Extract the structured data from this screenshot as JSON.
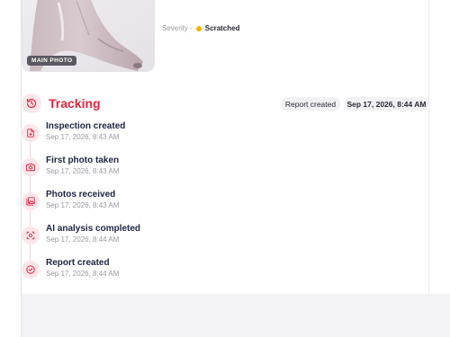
{
  "photo": {
    "tag": "MAIN PHOTO"
  },
  "severity": {
    "label": "Severity ·",
    "value": "Scratched",
    "dot_color": "#f4b400"
  },
  "tracking": {
    "title": "Tracking",
    "status_pill": "Report created",
    "date_pill": "Sep 17, 2026, 8:44 AM",
    "accent_color": "#e0243f",
    "events": [
      {
        "title": "Inspection created",
        "time": "Sep 17, 2026, 8:43 AM",
        "icon": "file-icon"
      },
      {
        "title": "First photo taken",
        "time": "Sep 17, 2026, 8:43 AM",
        "icon": "camera-icon"
      },
      {
        "title": "Photos received",
        "time": "Sep 17, 2026, 8:43 AM",
        "icon": "photos-icon"
      },
      {
        "title": "AI analysis completed",
        "time": "Sep 17, 2026, 8:44 AM",
        "icon": "ai-scan-icon"
      },
      {
        "title": "Report created",
        "time": "Sep 17, 2026, 8:44 AM",
        "icon": "check-circle-icon"
      }
    ]
  }
}
